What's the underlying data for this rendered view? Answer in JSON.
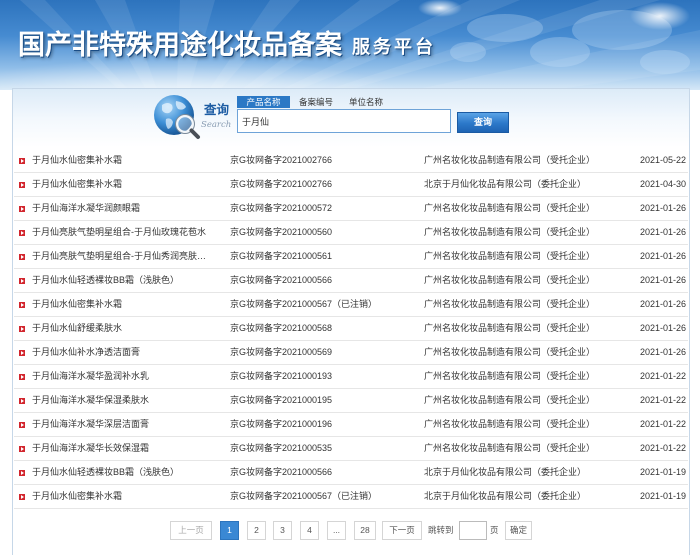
{
  "header": {
    "title": "国产非特殊用途化妆品备案",
    "subtitle": "服务平台"
  },
  "search": {
    "label": "查询",
    "label_en": "Search",
    "tabs": [
      {
        "label": "产品名称",
        "active": true
      },
      {
        "label": "备案编号",
        "active": false
      },
      {
        "label": "单位名称",
        "active": false
      }
    ],
    "query": "于月仙",
    "button_label": "查询"
  },
  "results": [
    {
      "product": "于月仙水仙密集补水霜",
      "record_no": "京G妆网备字2021002766",
      "company": "广州名妆化妆品制造有限公司（受托企业）",
      "date": "2021-05-22"
    },
    {
      "product": "于月仙水仙密集补水霜",
      "record_no": "京G妆网备字2021002766",
      "company": "北京于月仙化妆品有限公司（委托企业）",
      "date": "2021-04-30"
    },
    {
      "product": "于月仙海洋水凝华润颜眼霜",
      "record_no": "京G妆网备字2021000572",
      "company": "广州名妆化妆品制造有限公司（受托企业）",
      "date": "2021-01-26"
    },
    {
      "product": "于月仙亮肤气垫明星组合-于月仙玫瑰花苞水",
      "record_no": "京G妆网备字2021000560",
      "company": "广州名妆化妆品制造有限公司（受托企业）",
      "date": "2021-01-26"
    },
    {
      "product": "于月仙亮肤气垫明星组合-于月仙秀润亮肤…",
      "record_no": "京G妆网备字2021000561",
      "company": "广州名妆化妆品制造有限公司（受托企业）",
      "date": "2021-01-26"
    },
    {
      "product": "于月仙水仙轻透裸妆BB霜（浅肤色）",
      "record_no": "京G妆网备字2021000566",
      "company": "广州名妆化妆品制造有限公司（受托企业）",
      "date": "2021-01-26"
    },
    {
      "product": "于月仙水仙密集补水霜",
      "record_no": "京G妆网备字2021000567（已注销）",
      "company": "广州名妆化妆品制造有限公司（受托企业）",
      "date": "2021-01-26"
    },
    {
      "product": "于月仙水仙舒缓柔肤水",
      "record_no": "京G妆网备字2021000568",
      "company": "广州名妆化妆品制造有限公司（受托企业）",
      "date": "2021-01-26"
    },
    {
      "product": "于月仙水仙补水净透洁面膏",
      "record_no": "京G妆网备字2021000569",
      "company": "广州名妆化妆品制造有限公司（受托企业）",
      "date": "2021-01-26"
    },
    {
      "product": "于月仙海洋水凝华盈润补水乳",
      "record_no": "京G妆网备字2021000193",
      "company": "广州名妆化妆品制造有限公司（受托企业）",
      "date": "2021-01-22"
    },
    {
      "product": "于月仙海洋水凝华保湿柔肤水",
      "record_no": "京G妆网备字2021000195",
      "company": "广州名妆化妆品制造有限公司（受托企业）",
      "date": "2021-01-22"
    },
    {
      "product": "于月仙海洋水凝华深层洁面膏",
      "record_no": "京G妆网备字2021000196",
      "company": "广州名妆化妆品制造有限公司（受托企业）",
      "date": "2021-01-22"
    },
    {
      "product": "于月仙海洋水凝华长效保湿霜",
      "record_no": "京G妆网备字2021000535",
      "company": "广州名妆化妆品制造有限公司（受托企业）",
      "date": "2021-01-22"
    },
    {
      "product": "于月仙水仙轻透裸妆BB霜（浅肤色）",
      "record_no": "京G妆网备字2021000566",
      "company": "北京于月仙化妆品有限公司（委托企业）",
      "date": "2021-01-19"
    },
    {
      "product": "于月仙水仙密集补水霜",
      "record_no": "京G妆网备字2021000567（已注销）",
      "company": "北京于月仙化妆品有限公司（委托企业）",
      "date": "2021-01-19"
    }
  ],
  "pagination": {
    "prev_label": "上一页",
    "pages": [
      {
        "label": "1",
        "active": true
      },
      {
        "label": "2",
        "active": false
      },
      {
        "label": "3",
        "active": false
      },
      {
        "label": "4",
        "active": false
      },
      {
        "label": "...",
        "active": false
      },
      {
        "label": "28",
        "active": false
      }
    ],
    "next_label": "下一页",
    "jump_label": "跳转到",
    "jump_value": "",
    "page_unit": "页",
    "confirm_label": "确定"
  },
  "icons": {
    "search": "globe-search-icon",
    "row_bullet": "bullet-icon"
  },
  "colors": {
    "banner_blue": "#2d73bd",
    "accent": "#2b78c5",
    "active_page": "#3a88d4",
    "bullet": "#d2262e",
    "text": "#333333"
  }
}
